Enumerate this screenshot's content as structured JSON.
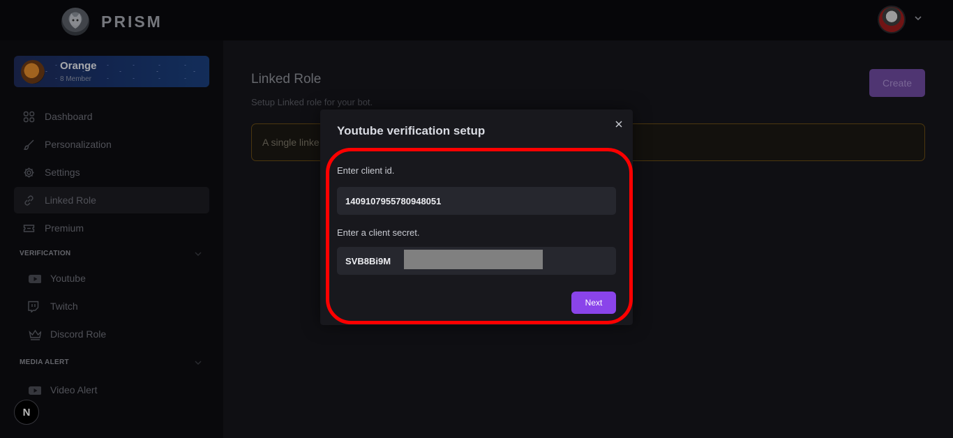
{
  "app": {
    "name": "PRISM"
  },
  "server": {
    "name": "Orange",
    "members": "8 Member"
  },
  "sidebar": {
    "items": [
      {
        "label": "Dashboard",
        "icon": "dashboard-icon"
      },
      {
        "label": "Personalization",
        "icon": "brush-icon"
      },
      {
        "label": "Settings",
        "icon": "gear-icon"
      },
      {
        "label": "Linked Role",
        "icon": "link-icon"
      },
      {
        "label": "Premium",
        "icon": "ticket-icon"
      }
    ],
    "verification": {
      "heading": "VERIFICATION",
      "items": [
        {
          "label": "Youtube",
          "icon": "youtube-icon"
        },
        {
          "label": "Twitch",
          "icon": "twitch-icon"
        },
        {
          "label": "Discord Role",
          "icon": "crown-icon"
        }
      ]
    },
    "media_alert": {
      "heading": "MEDIA ALERT",
      "items": [
        {
          "label": "Video Alert",
          "icon": "youtube-icon"
        }
      ]
    },
    "badge": "N"
  },
  "main": {
    "title": "Linked Role",
    "subtitle": "Setup Linked role for your bot.",
    "create_label": "Create",
    "alert_text": "A single linke"
  },
  "modal": {
    "title": "Youtube verification setup",
    "client_id_label": "Enter client id.",
    "client_id_value": "1409107955780948051",
    "client_secret_label": "Enter a client secret.",
    "client_secret_value": "SVB8Bi9M",
    "next_label": "Next"
  },
  "colors": {
    "accent": "#8a44ea",
    "highlight": "#ff0000",
    "alert_border": "#6a4d16"
  }
}
